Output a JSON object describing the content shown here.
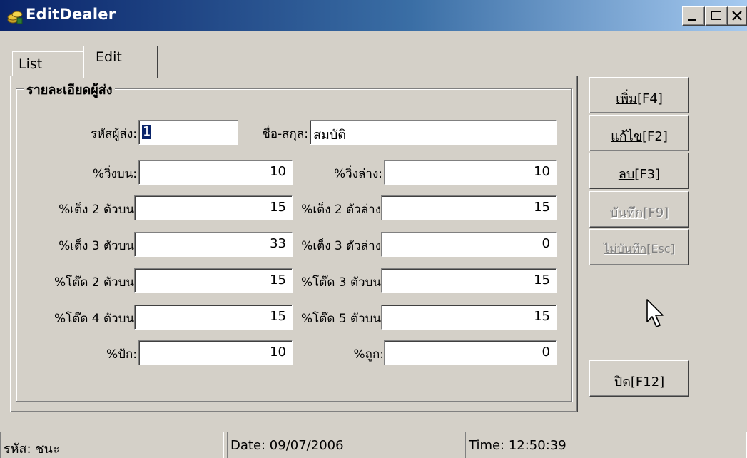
{
  "window": {
    "title": "EditDealer",
    "icon": "coins-app-icon"
  },
  "tabs": [
    {
      "label": "List",
      "active": false
    },
    {
      "label": "Edit",
      "active": true
    }
  ],
  "group": {
    "title": "รายละเอียดผู้ส่ง"
  },
  "fields": {
    "code": {
      "label": "รหัสผู้ส่ง:",
      "value": "1"
    },
    "name": {
      "label": "ชื่อ-สกุล:",
      "value": "สมบัติ"
    },
    "run_top": {
      "label": "%วิ่งบน:",
      "value": "10"
    },
    "run_bottom": {
      "label": "%วิ่งล่าง:",
      "value": "10"
    },
    "two_top": {
      "label": "%เต็ง 2 ตัวบน",
      "value": "15"
    },
    "two_bottom": {
      "label": "%เต็ง 2 ตัวล่าง",
      "value": "15"
    },
    "three_top": {
      "label": "%เต็ง 3 ตัวบน",
      "value": "33"
    },
    "three_bottom": {
      "label": "%เต็ง 3 ตัวล่าง",
      "value": "0"
    },
    "tod2_top": {
      "label": "%โต๊ด 2 ตัวบน",
      "value": "15"
    },
    "tod3_top": {
      "label": "%โต๊ด 3 ตัวบน",
      "value": "15"
    },
    "tod4_top": {
      "label": "%โต๊ด 4 ตัวบน",
      "value": "15"
    },
    "tod5_top": {
      "label": "%โต๊ด 5 ตัวบน",
      "value": "15"
    },
    "deduct": {
      "label": "%ปัก:",
      "value": "10"
    },
    "correct": {
      "label": "%ถูก:",
      "value": "0"
    }
  },
  "buttons": {
    "add": {
      "hot": "เพิ่ม",
      "key": "[F4]",
      "enabled": true
    },
    "edit": {
      "hot": "แก้ไข",
      "key": "[F2]",
      "enabled": true
    },
    "delete": {
      "hot": "ลบ",
      "key": "[F3]",
      "enabled": true
    },
    "save": {
      "hot": "บันทึก",
      "key": "[F9]",
      "enabled": false
    },
    "cancel": {
      "hot": "ไม่บันทึก",
      "key": "[Esc]",
      "enabled": false
    },
    "close": {
      "hot": "ปิด",
      "key": "[F12]",
      "enabled": true
    }
  },
  "status": {
    "user": "รหัส: ชนะ",
    "date": "Date: 09/07/2006",
    "time": "Time: 12:50:39"
  },
  "colors": {
    "titlebar_start": "#0a246a",
    "titlebar_end": "#a6caf0",
    "face": "#d4d0c8",
    "disabled_text": "#808080"
  }
}
